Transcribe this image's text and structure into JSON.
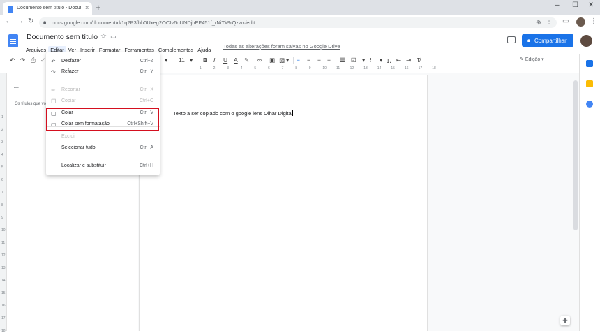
{
  "browser": {
    "tab_title": "Documento sem título - Docum",
    "tab_close": "×",
    "new_tab": "+",
    "window_controls": [
      "–",
      "☐",
      "✕"
    ],
    "url": "docs.google.com/document/d/1q2P3fhh0Uxeg2OCIv6oUNDjhEF451f_rNiTk9rQzwk/edit",
    "nav": {
      "back": "←",
      "forward": "→",
      "reload": "↻"
    }
  },
  "docs": {
    "doc_title": "Documento sem título",
    "menus": [
      "Arquivos",
      "Editar",
      "Ver",
      "Inserir",
      "Formatar",
      "Ferramentas",
      "Complementos",
      "Ajuda"
    ],
    "active_menu": "Editar",
    "saved_message": "Todas as alterações foram salvas no Google Drive",
    "share_label": "Compartilhar",
    "edit_mode": "Edição",
    "font_size": "11",
    "outline_text": "Os títulos que você adicionar ao documento aparecerão aqui.",
    "document_text": "Texto a ser copiado com o google lens Olhar Digital"
  },
  "ruler": [
    "1",
    "2",
    "3",
    "4",
    "5",
    "6",
    "7",
    "8",
    "9",
    "10",
    "11",
    "12",
    "13",
    "14",
    "15",
    "16",
    "17",
    "18"
  ],
  "edit_menu": {
    "items": [
      {
        "label": "Desfazer",
        "shortcut": "Ctrl+Z",
        "icon": "undo-icon",
        "glyph": "↶",
        "disabled": false
      },
      {
        "label": "Refazer",
        "shortcut": "Ctrl+Y",
        "icon": "redo-icon",
        "glyph": "↷",
        "disabled": false
      },
      {
        "label": "Recortar",
        "shortcut": "Ctrl+X",
        "icon": "cut-icon",
        "glyph": "✂",
        "disabled": true
      },
      {
        "label": "Copiar",
        "shortcut": "Ctrl+C",
        "icon": "copy-icon",
        "glyph": "❐",
        "disabled": true
      },
      {
        "label": "Colar",
        "shortcut": "Ctrl+V",
        "icon": "paste-icon",
        "glyph": "▢",
        "disabled": false
      },
      {
        "label": "Colar sem formatação",
        "shortcut": "Ctrl+Shift+V",
        "icon": "paste-plain-icon",
        "glyph": "▢",
        "disabled": false
      },
      {
        "label": "Excluir",
        "shortcut": "",
        "icon": "",
        "glyph": "",
        "disabled": true
      },
      {
        "label": "Selecionar tudo",
        "shortcut": "Ctrl+A",
        "icon": "",
        "glyph": "",
        "disabled": false
      },
      {
        "label": "Localizar e substituir",
        "shortcut": "Ctrl+H",
        "icon": "",
        "glyph": "",
        "disabled": false
      }
    ]
  },
  "colors": {
    "accent": "#1a73e8",
    "highlight_box": "#d40f1f",
    "docs_blue": "#4285f4"
  }
}
